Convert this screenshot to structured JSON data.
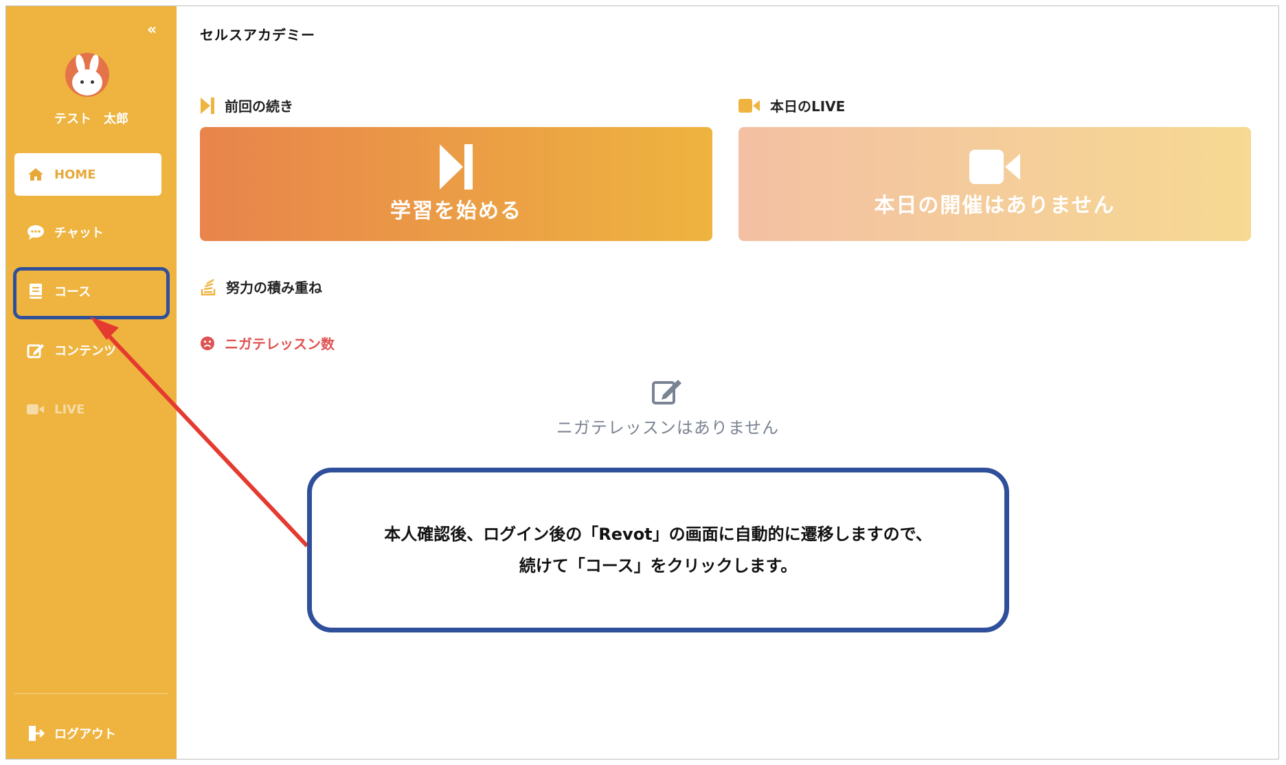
{
  "sidebar": {
    "collapse_glyph": "«",
    "user_name": "テスト　太郎",
    "items": [
      {
        "label": "HOME",
        "icon": "home-icon"
      },
      {
        "label": "チャット",
        "icon": "chat-icon"
      },
      {
        "label": "コース",
        "icon": "book-icon"
      },
      {
        "label": "コンテンツ",
        "icon": "edit-icon"
      },
      {
        "label": "LIVE",
        "icon": "video-icon"
      }
    ],
    "logout_label": "ログアウト"
  },
  "header": {
    "logo_text": "セルスアカデミー"
  },
  "sections": {
    "continue_label": "前回の続き",
    "live_label": "本日のLIVE",
    "effort_label": "努力の積み重ね",
    "nigate_label": "ニガテレッスン数"
  },
  "cards": {
    "start_title": "学習を始める",
    "live_title": "本日の開催はありません"
  },
  "empty_state": {
    "message": "ニガテレッスンはありません"
  },
  "callout": {
    "line1": "本人確認後、ログイン後の「Revot」の画面に自動的に遷移しますので、",
    "line2": "続けて「コース」をクリックします。"
  },
  "colors": {
    "sidebar": "#eeb43f",
    "accent_orange": "#e8844c",
    "annotation_blue": "#2f4f9a",
    "annotation_red": "#e53a2f",
    "nigate_red": "#e05252"
  }
}
